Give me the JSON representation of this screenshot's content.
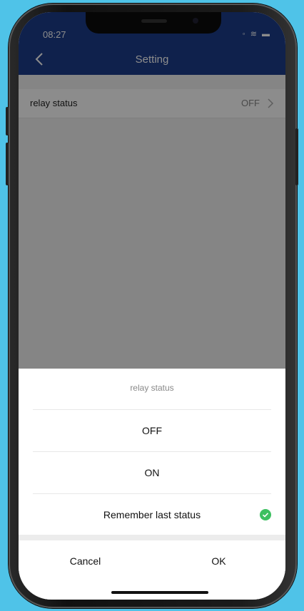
{
  "status_bar": {
    "time": "08:27",
    "icons": "◦ ≋ ▬"
  },
  "nav": {
    "title": "Setting"
  },
  "setting": {
    "label": "relay status",
    "value": "OFF"
  },
  "sheet": {
    "title": "relay status",
    "options": [
      {
        "label": "OFF"
      },
      {
        "label": "ON"
      },
      {
        "label": "Remember last status",
        "selected": true
      }
    ],
    "cancel_label": "Cancel",
    "ok_label": "OK"
  },
  "colors": {
    "nav": "#1d3d8a",
    "check": "#3cc060",
    "background": "#4fc3e8"
  }
}
